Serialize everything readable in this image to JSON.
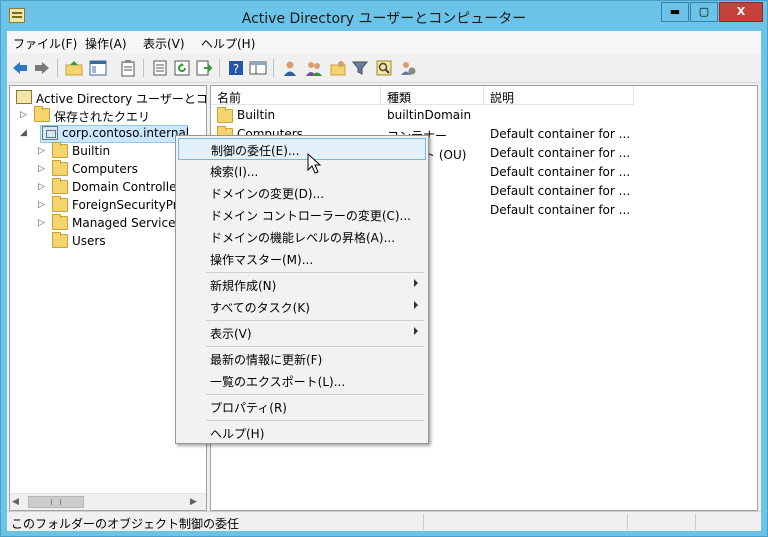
{
  "window": {
    "title": "Active Directory ユーザーとコンピューター",
    "min_glyph": "▬",
    "max_glyph": "▢",
    "close_glyph": "X"
  },
  "menubar": {
    "items": [
      "ファイル(F)",
      "操作(A)",
      "表示(V)",
      "ヘルプ(H)"
    ]
  },
  "toolbar": {
    "icons": [
      "back-arrow-icon",
      "forward-arrow-icon",
      "up-folder-icon",
      "console-tree-icon",
      "clipboard-icon",
      "properties-icon",
      "refresh-icon",
      "export-list-icon",
      "help-icon",
      "details-view-icon",
      "new-user-icon",
      "new-group-icon",
      "new-ou-icon",
      "filter-icon",
      "find-icon",
      "add-to-group-icon"
    ]
  },
  "tree": {
    "root_label": "Active Directory ユーザーとコンピ",
    "items": [
      {
        "label": "保存されたクエリ",
        "expander": "▷"
      },
      {
        "label": "corp.contoso.internal",
        "expander": "◢"
      },
      {
        "label": "Builtin",
        "expander": "▷"
      },
      {
        "label": "Computers",
        "expander": "▷"
      },
      {
        "label": "Domain Controlle",
        "expander": "▷"
      },
      {
        "label": "ForeignSecurityPr",
        "expander": "▷"
      },
      {
        "label": "Managed Service",
        "expander": "▷"
      },
      {
        "label": "Users",
        "expander": ""
      }
    ]
  },
  "list": {
    "columns": [
      "名前",
      "種類",
      "説明"
    ],
    "rows": [
      {
        "name": "Builtin",
        "type": "builtinDomain",
        "desc": ""
      },
      {
        "name": "Computers",
        "type": "コンテナー",
        "desc": "Default container for ..."
      },
      {
        "name": "",
        "type": "ユニット (OU)",
        "desc": "Default container for ..."
      },
      {
        "name": "",
        "type": "",
        "desc": "Default container for ..."
      },
      {
        "name": "",
        "type": "",
        "desc": "Default container for ..."
      },
      {
        "name": "",
        "type": "",
        "desc": "Default container for ..."
      }
    ]
  },
  "context_menu": {
    "items": [
      {
        "label": "制御の委任(E)...",
        "submenu": false
      },
      {
        "label": "検索(I)...",
        "submenu": false
      },
      {
        "label": "ドメインの変更(D)...",
        "submenu": false
      },
      {
        "label": "ドメイン コントローラーの変更(C)...",
        "submenu": false
      },
      {
        "label": "ドメインの機能レベルの昇格(A)...",
        "submenu": false
      },
      {
        "label": "操作マスター(M)...",
        "submenu": false
      },
      {
        "label": "新規作成(N)",
        "submenu": true
      },
      {
        "label": "すべてのタスク(K)",
        "submenu": true
      },
      {
        "label": "表示(V)",
        "submenu": true
      },
      {
        "label": "最新の情報に更新(F)",
        "submenu": false
      },
      {
        "label": "一覧のエクスポート(L)...",
        "submenu": false
      },
      {
        "label": "プロパティ(R)",
        "submenu": false
      },
      {
        "label": "ヘルプ(H)",
        "submenu": false
      }
    ],
    "highlighted_index": 0
  },
  "statusbar": {
    "text": "このフォルダーのオブジェクト制御の委任"
  },
  "colors": {
    "titlebar": "#6bc3e8",
    "close_button": "#c7413b",
    "highlight": "#e3f1fb",
    "folder": "#f5d36f"
  }
}
